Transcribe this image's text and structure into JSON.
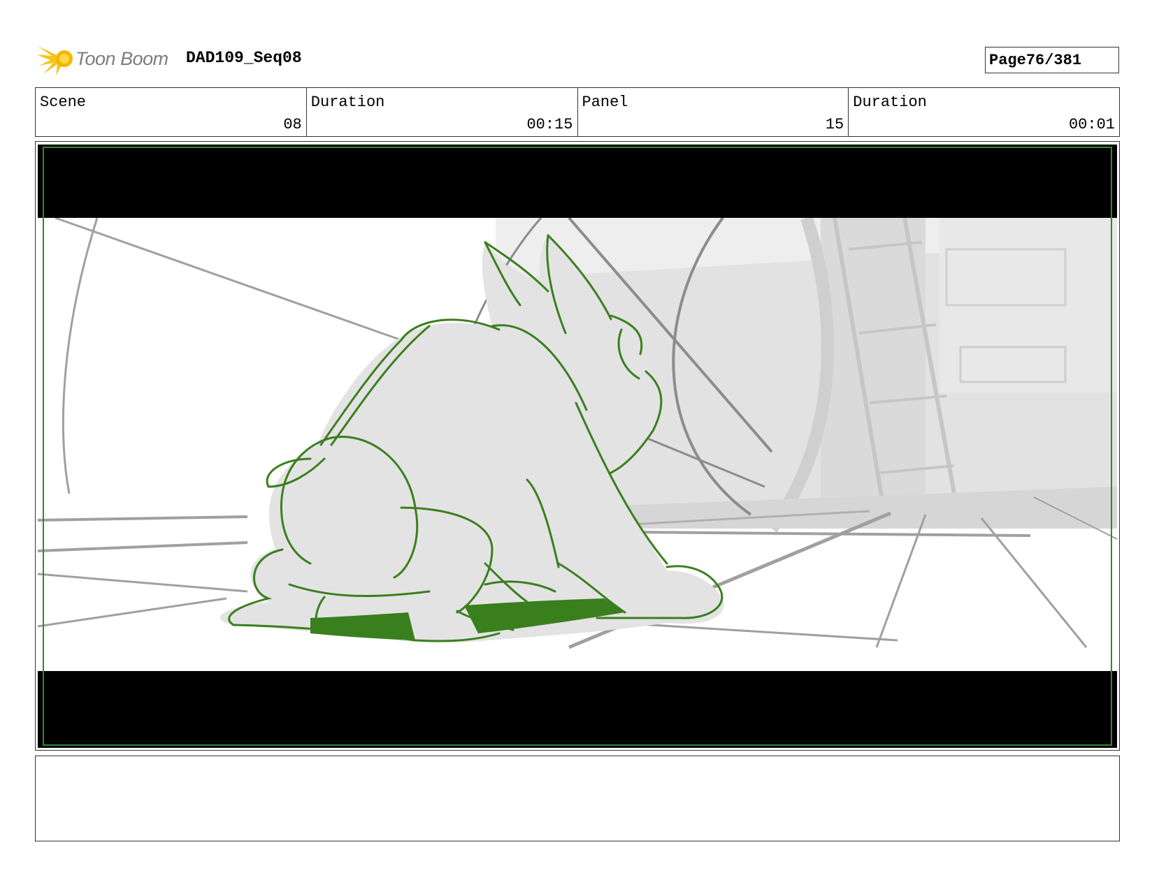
{
  "header": {
    "logo_text": "Toon Boom",
    "project": "DAD109_Seq08",
    "page_label": "Page",
    "page_value": "76/381"
  },
  "info": {
    "scene_label": "Scene",
    "scene_value": "08",
    "scene_duration_label": "Duration",
    "scene_duration_value": "00:15",
    "panel_label": "Panel",
    "panel_value": "15",
    "panel_duration_label": "Duration",
    "panel_duration_value": "00:01"
  },
  "notes": {
    "text": ""
  },
  "colors": {
    "sketch_green": "#3a7f1e",
    "letterbox": "#000000",
    "guide_green": "#2f8a2f",
    "background_gray": "#e2e2e2",
    "line_gray": "#a0a0a0"
  }
}
